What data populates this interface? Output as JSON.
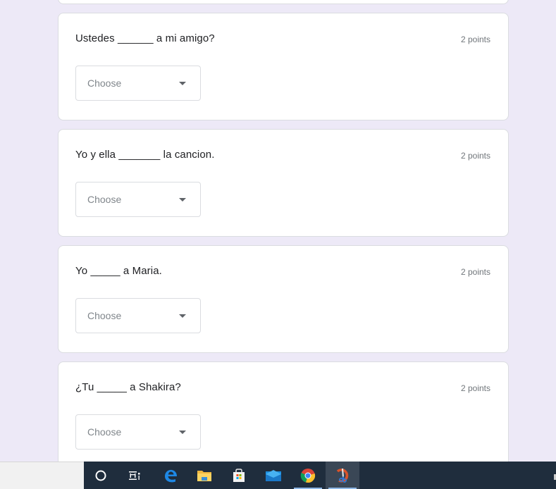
{
  "questions": [
    {
      "text": "Ustedes ______ a mi amigo?",
      "points": "2 points",
      "dropdown": {
        "placeholder": "Choose"
      }
    },
    {
      "text": "Yo y ella _______ la cancion.",
      "points": "2 points",
      "dropdown": {
        "placeholder": "Choose"
      }
    },
    {
      "text": "Yo _____ a Maria.",
      "points": "2 points",
      "dropdown": {
        "placeholder": "Choose"
      }
    },
    {
      "text": "¿Tu _____ a Shakira?",
      "points": "2 points",
      "dropdown": {
        "placeholder": "Choose"
      }
    }
  ],
  "taskbar": {
    "items": [
      {
        "icon": "cortana-icon"
      },
      {
        "icon": "task-view-icon"
      },
      {
        "icon": "edge-icon"
      },
      {
        "icon": "file-explorer-icon"
      },
      {
        "icon": "store-icon"
      },
      {
        "icon": "mail-icon"
      },
      {
        "icon": "chrome-icon"
      },
      {
        "icon": "snipping-tool-icon"
      }
    ]
  },
  "colors": {
    "page_background": "#ede9f7",
    "taskbar": "#1f2d3d"
  }
}
